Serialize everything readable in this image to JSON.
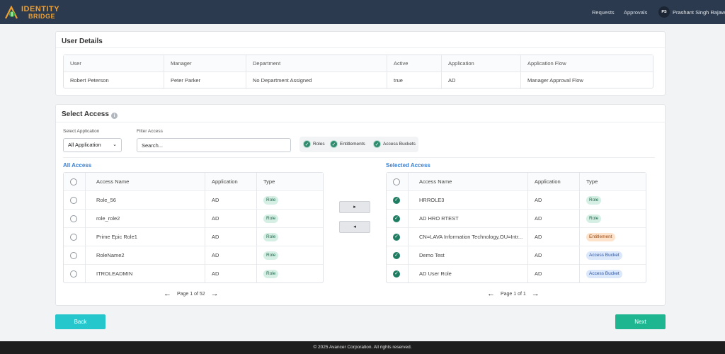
{
  "header": {
    "logo_line1": "IDENTITY",
    "logo_line2": "BRIDGE",
    "nav": [
      "Requests",
      "Approvals"
    ],
    "avatar_initials": "PS",
    "user_name": "Prashant Singh Rajawat"
  },
  "user_details": {
    "title": "User Details",
    "columns": [
      "User",
      "Manager",
      "Department",
      "Active",
      "Application",
      "Application Flow"
    ],
    "row": [
      "Robert Peterson",
      "Peter Parker",
      "No Department Assigned",
      "true",
      "AD",
      "Manager Approval Flow"
    ]
  },
  "select_access": {
    "title": "Select Access",
    "info_icon": "i",
    "select_application_label": "Select Application",
    "select_application_value": "All Application",
    "filter_label": "Filter Access",
    "filter_placeholder": "Search...",
    "filters": [
      "Roles",
      "Entitlements",
      "Access Buckets"
    ],
    "move_right_label": "▸",
    "move_left_label": "◂"
  },
  "all_access": {
    "title": "All Access",
    "columns": [
      "Access Name",
      "Application",
      "Type"
    ],
    "rows": [
      {
        "name": "Role_56",
        "app": "AD",
        "type": "Role"
      },
      {
        "name": "role_role2",
        "app": "AD",
        "type": "Role"
      },
      {
        "name": "Prime Epic Role1",
        "app": "AD",
        "type": "Role"
      },
      {
        "name": "RoleName2",
        "app": "AD",
        "type": "Role"
      },
      {
        "name": "ITROLEADMIN",
        "app": "AD",
        "type": "Role"
      }
    ],
    "pager_text": "Page 1 of 52"
  },
  "selected_access": {
    "title": "Selected Access",
    "columns": [
      "Access Name",
      "Application",
      "Type"
    ],
    "rows": [
      {
        "name": "HRROLE3",
        "app": "AD",
        "type": "Role"
      },
      {
        "name": "AD HRO RTEST",
        "app": "AD",
        "type": "Role"
      },
      {
        "name": "CN=LAVA Information Technology,OU=Intr...",
        "app": "AD",
        "type": "Entitlement"
      },
      {
        "name": "Demo Test",
        "app": "AD",
        "type": "Access Bucket"
      },
      {
        "name": "AD User Role",
        "app": "AD",
        "type": "Access Bucket"
      }
    ],
    "pager_text": "Page 1 of 1"
  },
  "actions": {
    "back_label": "Back",
    "next_label": "Next"
  },
  "footer": {
    "text": "© 2025 Avancer Corporation. All rights reserved."
  },
  "colors": {
    "topbar": "#2b3a4e",
    "link_blue": "#3a7fd0",
    "check_green": "#1f7d62",
    "back_button": "#25c6cc",
    "next_button": "#1eb591"
  }
}
